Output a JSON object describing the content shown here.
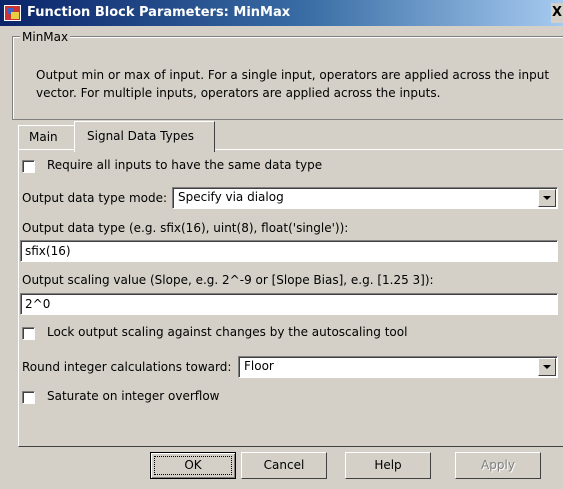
{
  "window": {
    "title": "Function Block Parameters: MinMax",
    "close_label": "X"
  },
  "group": {
    "legend": "MinMax",
    "description_line1": "Output min or max of input.  For a single input, operators are applied across the input",
    "description_line2": "vector.  For multiple inputs, operators are applied across the inputs."
  },
  "tabs": [
    {
      "label": "Main",
      "selected": false
    },
    {
      "label": "Signal Data Types",
      "selected": true
    }
  ],
  "params": {
    "require_same_type": {
      "label": "Require all inputs to have the same data type",
      "checked": false
    },
    "output_mode": {
      "label": "Output data type mode:",
      "value": "Specify via dialog"
    },
    "output_type": {
      "label": "Output data type (e.g. sfix(16), uint(8), float('single')):",
      "value": "sfix(16)"
    },
    "output_scaling": {
      "label": "Output scaling value (Slope, e.g. 2^-9 or [Slope Bias], e.g. [1.25 3]):",
      "value": "2^0"
    },
    "lock_scaling": {
      "label": "Lock output scaling against changes by the autoscaling tool",
      "checked": false
    },
    "round_toward": {
      "label": "Round integer calculations toward:",
      "value": "Floor"
    },
    "saturate": {
      "label": "Saturate on integer overflow",
      "checked": false
    }
  },
  "buttons": {
    "ok": "OK",
    "cancel": "Cancel",
    "help": "Help",
    "apply": "Apply"
  }
}
